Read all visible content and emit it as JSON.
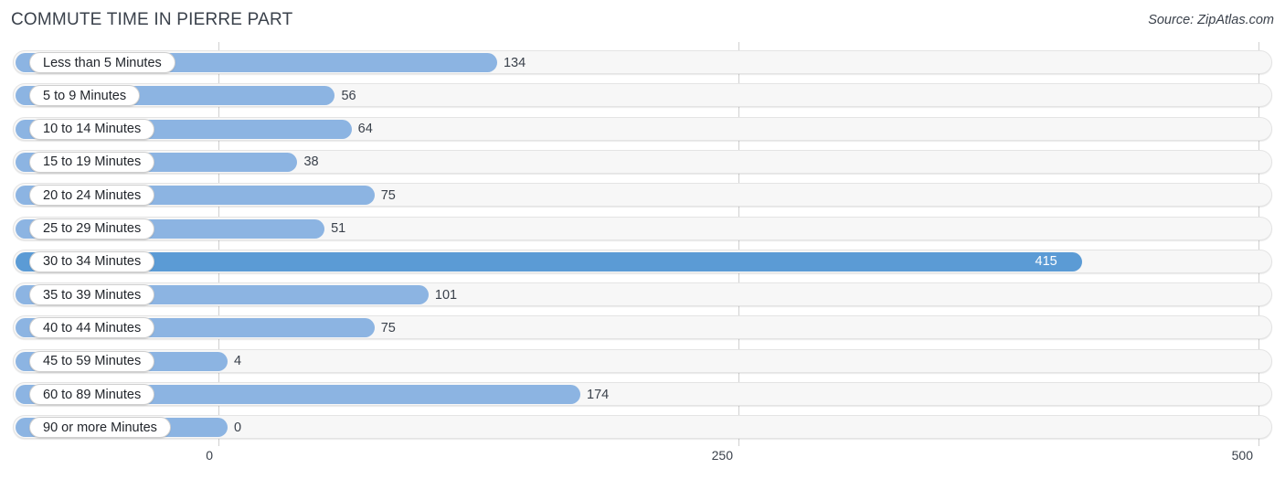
{
  "header": {
    "title": "COMMUTE TIME IN PIERRE PART",
    "source": "Source: ZipAtlas.com"
  },
  "axis": {
    "ticks": [
      "0",
      "250",
      "500"
    ]
  },
  "chart_data": {
    "type": "bar",
    "orientation": "horizontal",
    "title": "COMMUTE TIME IN PIERRE PART",
    "source": "Source: ZipAtlas.com",
    "xlabel": "",
    "ylabel": "",
    "xlim": [
      0,
      500
    ],
    "xticks": [
      0,
      250,
      500
    ],
    "grid": true,
    "legend": false,
    "highlight_color": "#5b9bd5",
    "bar_color": "#8cb4e2",
    "categories": [
      "Less than 5 Minutes",
      "5 to 9 Minutes",
      "10 to 14 Minutes",
      "15 to 19 Minutes",
      "20 to 24 Minutes",
      "25 to 29 Minutes",
      "30 to 34 Minutes",
      "35 to 39 Minutes",
      "40 to 44 Minutes",
      "45 to 59 Minutes",
      "60 to 89 Minutes",
      "90 or more Minutes"
    ],
    "values": [
      134,
      56,
      64,
      38,
      75,
      51,
      415,
      101,
      75,
      4,
      174,
      0
    ],
    "highlighted": [
      "30 to 34 Minutes"
    ],
    "rows": [
      {
        "label": "Less than 5 Minutes",
        "value": 134,
        "value_text": "134",
        "highlight": false
      },
      {
        "label": "5 to 9 Minutes",
        "value": 56,
        "value_text": "56",
        "highlight": false
      },
      {
        "label": "10 to 14 Minutes",
        "value": 64,
        "value_text": "64",
        "highlight": false
      },
      {
        "label": "15 to 19 Minutes",
        "value": 38,
        "value_text": "38",
        "highlight": false
      },
      {
        "label": "20 to 24 Minutes",
        "value": 75,
        "value_text": "75",
        "highlight": false
      },
      {
        "label": "25 to 29 Minutes",
        "value": 51,
        "value_text": "51",
        "highlight": false
      },
      {
        "label": "30 to 34 Minutes",
        "value": 415,
        "value_text": "415",
        "highlight": true
      },
      {
        "label": "35 to 39 Minutes",
        "value": 101,
        "value_text": "101",
        "highlight": false
      },
      {
        "label": "40 to 44 Minutes",
        "value": 75,
        "value_text": "75",
        "highlight": false
      },
      {
        "label": "45 to 59 Minutes",
        "value": 4,
        "value_text": "4",
        "highlight": false
      },
      {
        "label": "60 to 89 Minutes",
        "value": 174,
        "value_text": "174",
        "highlight": false
      },
      {
        "label": "90 or more Minutes",
        "value": 0,
        "value_text": "0",
        "highlight": false
      }
    ]
  }
}
